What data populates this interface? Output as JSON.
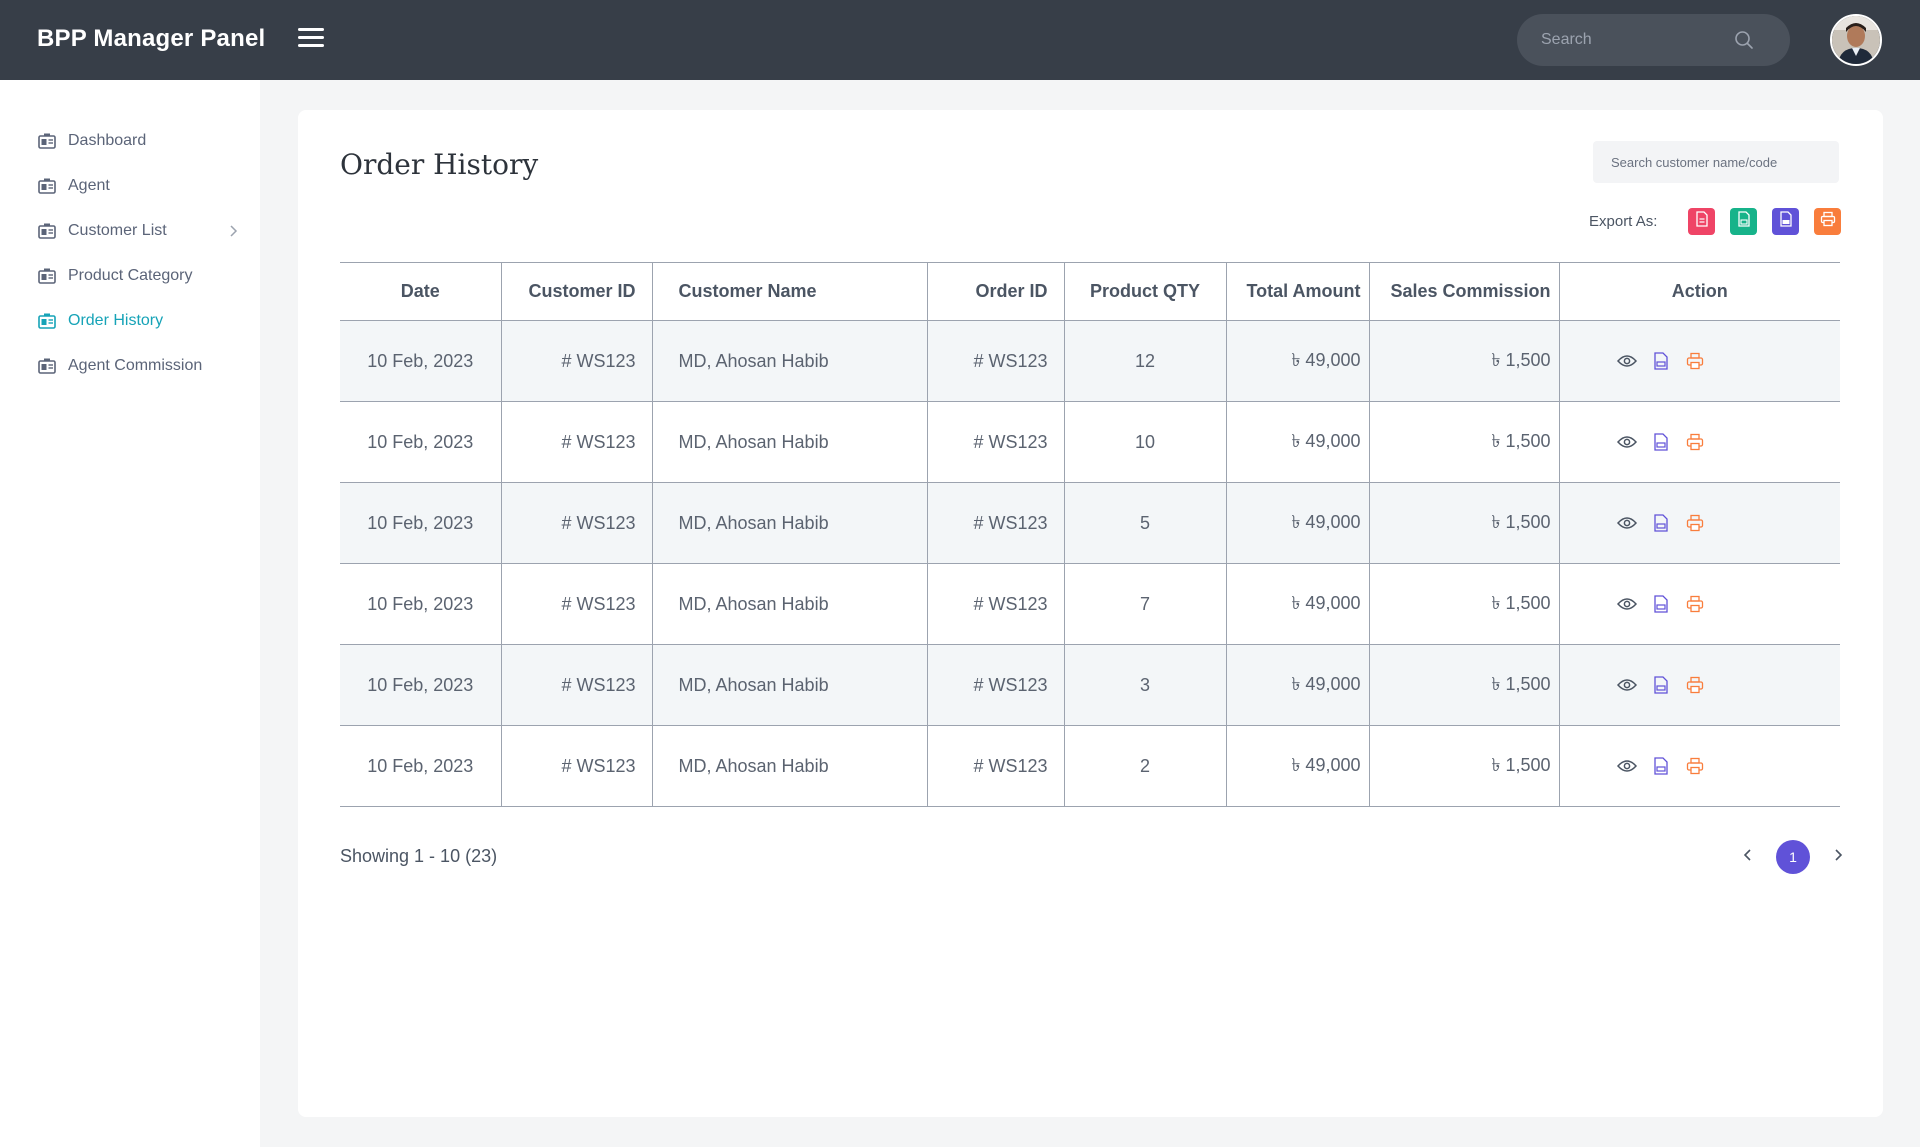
{
  "app": {
    "title": "BPP Manager Panel"
  },
  "header": {
    "search_placeholder": "Search"
  },
  "sidebar": {
    "items": [
      {
        "label": "Dashboard",
        "active": false
      },
      {
        "label": "Agent",
        "active": false
      },
      {
        "label": "Customer List",
        "active": false,
        "has_children": true
      },
      {
        "label": "Product Category",
        "active": false
      },
      {
        "label": "Order History",
        "active": true
      },
      {
        "label": "Agent Commission",
        "active": false
      }
    ]
  },
  "main": {
    "title": "Order History",
    "search_placeholder": "Search customer name/code",
    "export_label": "Export As:",
    "export_buttons": [
      {
        "icon": "pdf-icon",
        "color": "#ef4466"
      },
      {
        "icon": "excel-icon",
        "color": "#17b38a"
      },
      {
        "icon": "csv-icon",
        "color": "#6052d8"
      },
      {
        "icon": "print-icon",
        "color": "#f97d3c"
      }
    ],
    "table": {
      "columns": [
        "Date",
        "Customer ID",
        "Customer Name",
        "Order ID",
        "Product QTY",
        "Total Amount",
        "Sales Commission",
        "Action"
      ],
      "rows": [
        [
          "10 Feb, 2023",
          "# WS123",
          "MD, Ahosan Habib",
          "# WS123",
          "12",
          "৳ 49,000",
          "৳ 1,500"
        ],
        [
          "10 Feb, 2023",
          "# WS123",
          "MD, Ahosan Habib",
          "# WS123",
          "10",
          "৳ 49,000",
          "৳ 1,500"
        ],
        [
          "10 Feb, 2023",
          "# WS123",
          "MD, Ahosan Habib",
          "# WS123",
          "5",
          "৳ 49,000",
          "৳ 1,500"
        ],
        [
          "10 Feb, 2023",
          "# WS123",
          "MD, Ahosan Habib",
          "# WS123",
          "7",
          "৳ 49,000",
          "৳ 1,500"
        ],
        [
          "10 Feb, 2023",
          "# WS123",
          "MD, Ahosan Habib",
          "# WS123",
          "3",
          "৳ 49,000",
          "৳ 1,500"
        ],
        [
          "10 Feb, 2023",
          "# WS123",
          "MD, Ahosan Habib",
          "# WS123",
          "2",
          "৳ 49,000",
          "৳ 1,500"
        ]
      ]
    },
    "pagination": {
      "showing": "Showing 1 - 10 (23)",
      "current_page": "1"
    }
  },
  "colors": {
    "accent": "#16a3b7",
    "header_bg": "#373e48",
    "page_active": "#6052d8"
  }
}
